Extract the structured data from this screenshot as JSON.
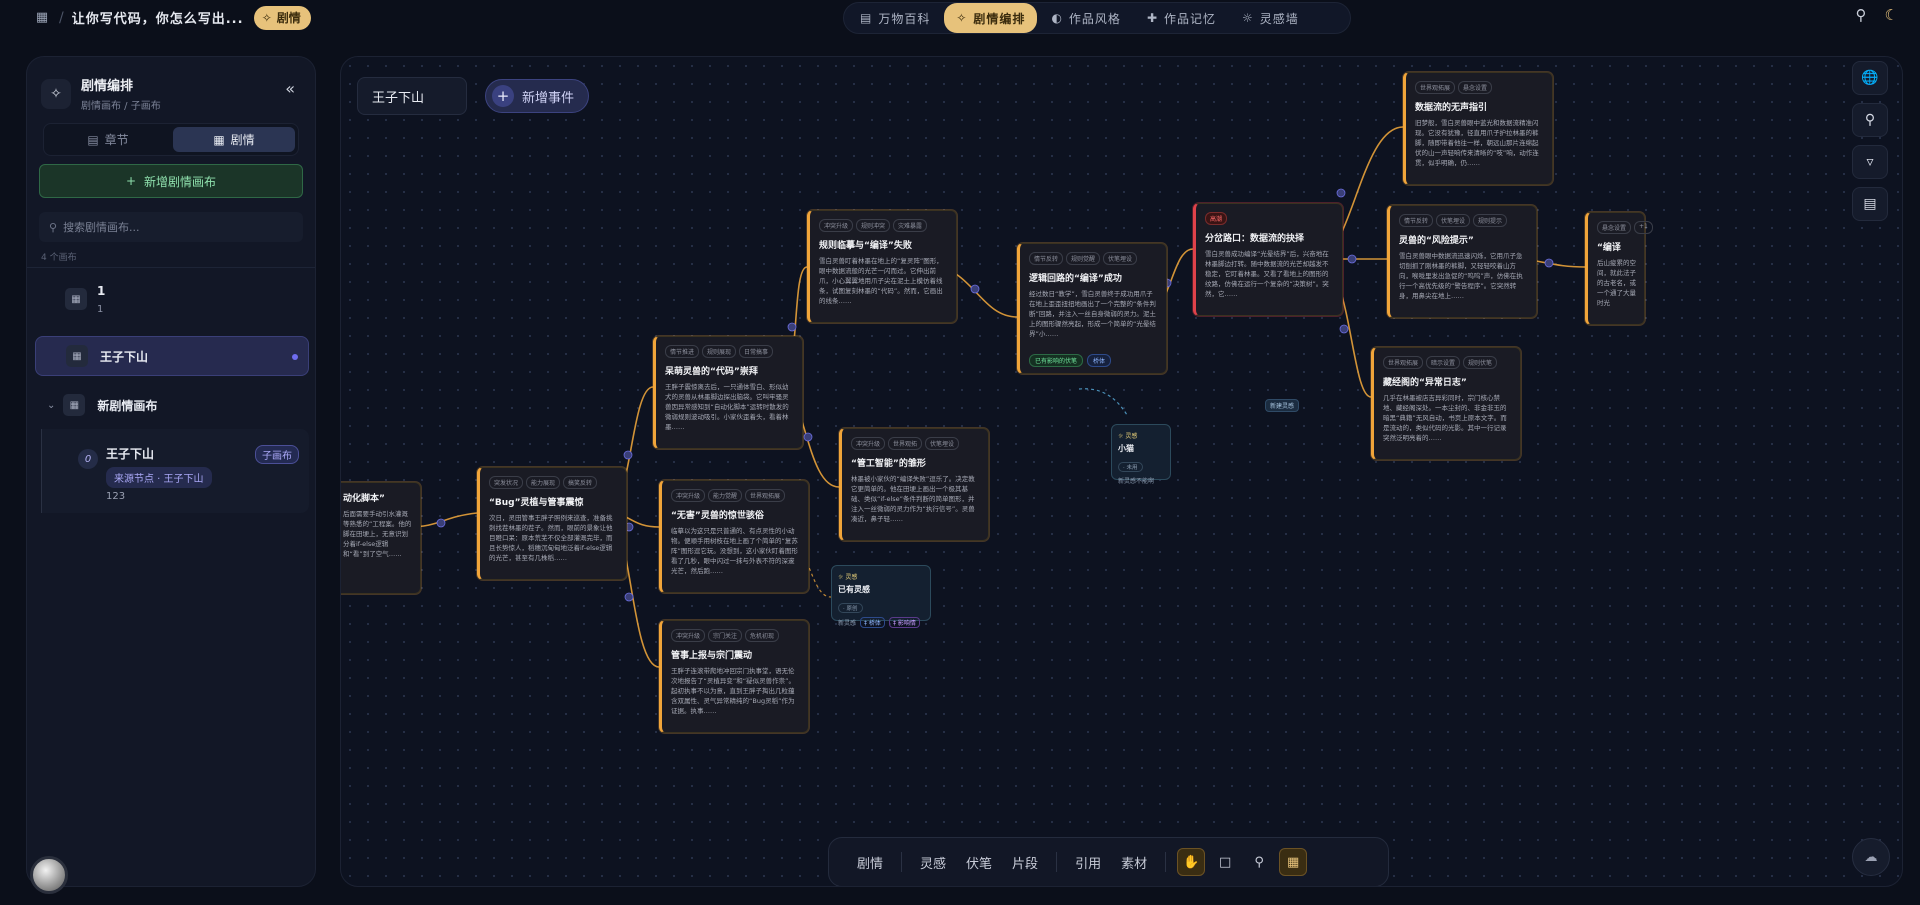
{
  "topbar": {
    "doc_title": "让你写代码，你怎么写出...",
    "chip": "剧情",
    "tabs": [
      {
        "label": "万物百科",
        "icon": "book-icon"
      },
      {
        "label": "剧情编排",
        "icon": "plot-icon",
        "active": true
      },
      {
        "label": "作品风格",
        "icon": "palette-icon"
      },
      {
        "label": "作品记忆",
        "icon": "memory-icon"
      },
      {
        "label": "灵感墙",
        "icon": "bulb-icon"
      }
    ]
  },
  "sidebar": {
    "title": "剧情编排",
    "subtitle": "剧情画布 / 子画布",
    "seg": [
      "章节",
      "剧情"
    ],
    "new_canvas": "新增剧情画布",
    "search_placeholder": "搜索剧情画布...",
    "count": "4 个画布",
    "items": [
      {
        "name": "1",
        "meta": "1"
      },
      {
        "name": "王子下山"
      },
      {
        "name": "新剧情画布"
      }
    ],
    "sub": {
      "num": "0",
      "name": "王子下山",
      "tag": "子画布",
      "source": "来源节点 · 王子下山",
      "desc": "123"
    }
  },
  "canvas": {
    "name": "王子下山",
    "add_event": "新增事件",
    "nodes": [
      {
        "tags": [],
        "title": "动化脚本”",
        "body": "后面需要手动引水灌溉等熟悉的“工程案。他的脚在田埂上，无意识划分着if-else逻辑和“看”到了空气……"
      },
      {
        "tags": [
          "突发状况",
          "能力展现",
          "搞笑反转"
        ],
        "title": "“Bug”灵植与管事震惊",
        "body": "次日，灵田管事王胖子照例来巡查，准备挑刺找茬林墨的茬子。然而，眼前的景象让他目瞪口呆：原本荒芜不仅全部灌溉完毕，而且长势惊人，稻穗沉甸甸地泛着if-else逻辑的光芒，甚至有几株稻……"
      },
      {
        "tags": [
          "情节推进",
          "规则展现",
          "日常搞事"
        ],
        "title": "呆萌灵兽的“代码”崇拜",
        "body": "王胖子震惊离去后，一只通体雪白、形似幼犬的灵兽从林墨脚边探出脑袋。它叫牢骚灵兽因异常感知到“自动化脚本”运转时散发的微弱规则波动吸引。小家伙歪着头，看着林墨……"
      },
      {
        "tags": [
          "冲突升级",
          "能力觉醒",
          "世界观拓展"
        ],
        "title": "“无害”灵兽的惊世骇俗",
        "body": "临摹以为这只是只普通的、有点灵性的小动物。便顺手用树枝在地上画了个简单的“复苏阵”图形逗它玩。没想到，这小家伙盯着图形看了几秒，眼中闪过一抹与外表不符的深邃光芒，然后跑……"
      },
      {
        "tags": [
          "冲突升级",
          "宗门关注",
          "危机初现"
        ],
        "title": "管事上报与宗门震动",
        "body": "王胖子连滚带爬地冲回宗门执事堂，语无伦次地报告了“灵植异变”和“疑似灵兽作祟”。起初执事不以为意，直到王胖子掏出几粒蕴含双属性、灵气异常精纯的“Bug灵稻”作为证据。执事……"
      },
      {
        "tags": [
          "冲突升级",
          "规则冲突",
          "灾难暴露"
        ],
        "title": "规则临摹与“编译”失败",
        "body": "雪白灵兽盯着林墨在地上的“复灵阵”图形，眼中数据流般的光芒一闪而过。它伸出前爪，小心翼翼地用爪子尖在泥土上模仿着线条，试图复刻林墨的“代码”。然而，它画出的线条……"
      },
      {
        "tags": [
          "冲突升级",
          "世界观拓",
          "伏笔埋设"
        ],
        "title": "“管工智能”的雏形",
        "body": "林墨被小家伙的“编译失败”逗乐了。决定教它更简单的。他在田埂上画出一个极其基础、类似“if-else”条件判断的简单图形，并注入一丝微弱的灵力作为“执行信号”。灵兽凑近，鼻子轻……"
      },
      {
        "tags": [
          "情节反转",
          "规则觉醒",
          "伏笔埋设"
        ],
        "title": "逻辑回路的“编译”成功",
        "body": "经过数日“教学”，雪白灵兽终于成功用爪子在地上歪歪扭扭地画出了一个完整的“条件判断”回路，并注入一丝自身微弱的灵力。泥土上的图形骤然亮起，形成一个简单的“光晕结界”小……",
        "badges": [
          "已有影响的伏笔",
          "桥体"
        ]
      },
      {
        "tags": [
          "高潮"
        ],
        "title": "分岔路口：数据流的抉择",
        "body": "雪白灵兽成功编译“光晕结界”后，兴奋地在林墨脚边打转。随中数据流的光芒却越发不稳定，它盯着林墨。又看了看地上的图形的纹路，仿佛在运行一个复杂的“决策树”。突然，它……"
      },
      {
        "tags": [
          "世界观拓展",
          "悬念设置",
          "伏笔埋设"
        ],
        "title": "数据流的无声指引",
        "body": "旧梦般，雪白灵兽眼中蓝光和数据流精准闪现。它没有犹豫，径直用爪子护拉林墨的裤脚，随即带着他往一样，朝远山那片连绵起伏的山一声轻响传来清晰的“吱”响，动作连贯，似乎明确，仍……"
      },
      {
        "tags": [
          "情节反转",
          "伏笔埋设",
          "规则提示"
        ],
        "title": "灵兽的“风险提示”",
        "body": "雪白灵兽眼中数据流迅速闪烁，它用爪子急切刨抓了刚林墨的裤脚，又轻轻咬着山方向，喉咙里发出急促的“呜呜”声，仿佛在执行一个高优先级的“警告程序”。它突然转身，用鼻尖在地上……"
      },
      {
        "tags": [
          "世界观拓展",
          "暗示设置",
          "规则伏笔"
        ],
        "title": "藏经阁的“异常日志”",
        "body": "几乎在林墨被店吉异彩同时，宗门核心禁地、藏经阁深处。一本尘封的、非金非玉的暗黑“典籍”无风自动，书页上原本文字。而是流动的，类似代码的光影。其中一行记录突然泛明亮着的……"
      },
      {
        "tags": [
          "悬念设置",
          "+1"
        ],
        "title": "“编译",
        "body": "后山疲累的空间，就此法子的古老名，或一个通了大量时光"
      }
    ],
    "ideas": [
      {
        "type": "灵感",
        "title": "小猫",
        "pill": "· 未用",
        "foot": "新灵感不能啊"
      },
      {
        "type": "灵感",
        "title": "已有灵感",
        "pill": "· 原创",
        "foot": "新灵感",
        "b1": "‡ 桥体",
        "b2": "‡ 影响情"
      }
    ],
    "drag_label": "新建灵感"
  },
  "bottom_bar": {
    "items": [
      "剧情",
      "灵感",
      "伏笔",
      "片段",
      "引用",
      "素材"
    ]
  }
}
